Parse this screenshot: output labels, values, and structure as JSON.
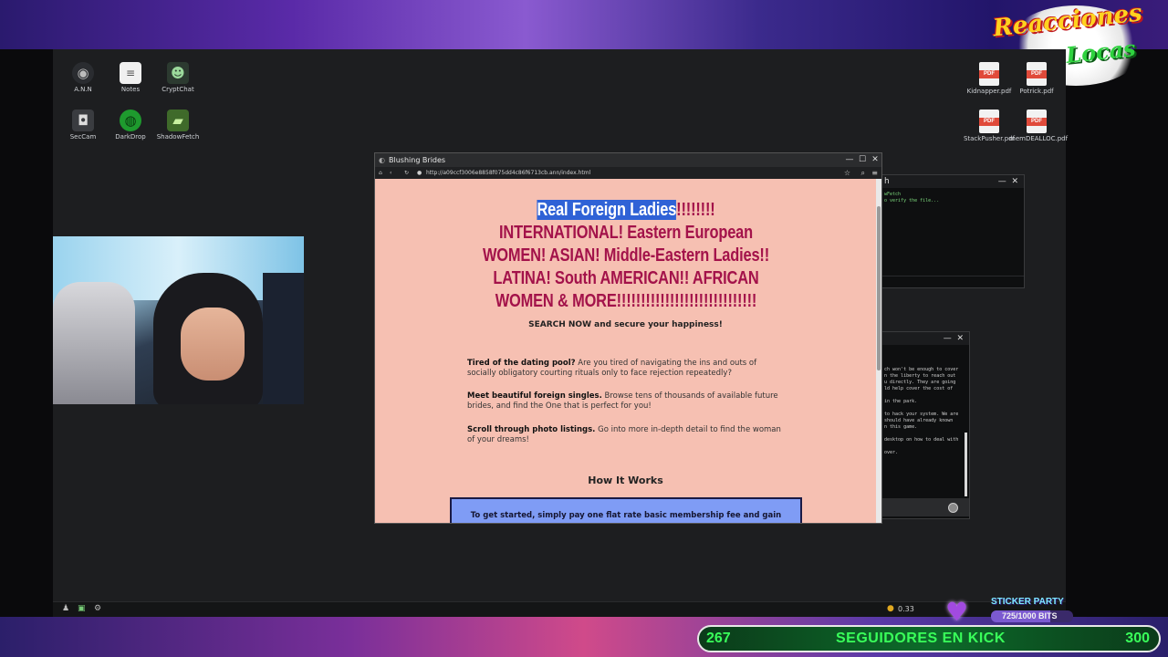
{
  "overlay": {
    "logo_line1": "Reacciones",
    "logo_line2": "Locas",
    "sticker_title": "STICKER PARTY",
    "sticker_progress": "725/1000 BITS",
    "followers_current": "267",
    "followers_label": "SEGUIDORES EN KICK",
    "followers_goal": "300",
    "colors": {
      "follow_text": "#39ff5a",
      "headline": "#a3124a",
      "page_bg": "#f6c0b2",
      "highlight": "#2f62d6"
    }
  },
  "desktop": {
    "icons_left": [
      {
        "label": "A.N.N",
        "icon": "globe-dark-icon"
      },
      {
        "label": "Notes",
        "icon": "notes-icon"
      },
      {
        "label": "CryptChat",
        "icon": "hacker-icon"
      },
      {
        "label": "SecCam",
        "icon": "camera-icon"
      },
      {
        "label": "DarkDrop",
        "icon": "green-globe-icon"
      },
      {
        "label": "ShadowFetch",
        "icon": "folder-icon"
      }
    ],
    "icons_right": [
      {
        "label": "Kidnapper.pdf"
      },
      {
        "label": "Potrick.pdf"
      },
      {
        "label": "StackPusher.pdf"
      },
      {
        "label": "memDEALLOC.pdf"
      }
    ],
    "pdf_badge": "PDF"
  },
  "bg_window_1": {
    "title_fragment": "h",
    "lines": [
      "wFetch",
      "o verify the file..."
    ]
  },
  "bg_window_2": {
    "lines": [
      "ch won't be enough to cover",
      "n the liberty to reach out",
      "u directly. They are going",
      "ld help cover the cost of",
      "",
      "in the park.",
      "",
      "to hack your system. We are",
      "should have already known",
      "n this game.",
      "",
      "desktop on how to deal with",
      "",
      "over."
    ]
  },
  "browser": {
    "title": "Blushing Brides",
    "url": "http://a09ccf3006e8858f075dd4c86f6713cb.ann/index.html",
    "headline_highlight": "Real Foreign Ladies",
    "headline_rest": "!!!!!!!! INTERNATIONAL! Eastern European WOMEN! ASIAN! Middle-Eastern Ladies!! LATINA! South AMERICAN!! AFRICAN WOMEN & MORE!!!!!!!!!!!!!!!!!!!!!!!!!!!!!",
    "search_now": "SEARCH NOW and secure your happiness!",
    "paragraphs": [
      {
        "bold": "Tired of the dating pool?",
        "text": " Are you tired of navigating the ins and outs of socially obligatory courting rituals only to face rejection repeatedly?"
      },
      {
        "bold": "Meet beautiful foreign singles.",
        "text": " Browse tens of thousands of available future brides, and find the One that is perfect for you!"
      },
      {
        "bold": "Scroll through photo listings.",
        "text": " Go into more in-depth detail to find the woman of your dreams!"
      }
    ],
    "how_it_works": "How It Works",
    "box_text": "To get started, simply pay one flat rate basic membership fee and gain"
  },
  "taskbar": {
    "balance": "0.33"
  }
}
